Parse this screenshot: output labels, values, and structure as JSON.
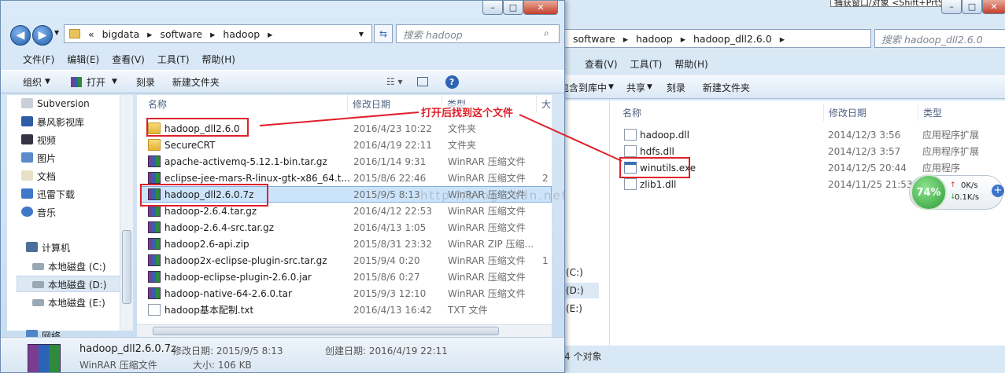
{
  "tooltip_text": "捕获窗口/对象 <Shift+PrtSc>",
  "left_window": {
    "address": [
      "«",
      "bigdata",
      "software",
      "hadoop"
    ],
    "search_placeholder": "搜索 hadoop",
    "menu": [
      "文件(F)",
      "编辑(E)",
      "查看(V)",
      "工具(T)",
      "帮助(H)"
    ],
    "toolbar": {
      "organize": "组织",
      "open": "打开",
      "burn": "刻录",
      "new_folder": "新建文件夹"
    },
    "nav": [
      "Subversion",
      "暴风影视库",
      "视频",
      "图片",
      "文档",
      "迅雷下载",
      "音乐",
      "计算机",
      "本地磁盘 (C:)",
      "本地磁盘 (D:)",
      "本地磁盘 (E:)",
      "网络"
    ],
    "columns": [
      "名称",
      "修改日期",
      "类型",
      "大"
    ],
    "files": [
      {
        "name": "hadoop_dll2.6.0",
        "date": "2016/4/23 10:22",
        "type": "文件夹",
        "size": "",
        "icon": "folder"
      },
      {
        "name": "SecureCRT",
        "date": "2016/4/19 22:11",
        "type": "文件夹",
        "size": "",
        "icon": "folder"
      },
      {
        "name": "apache-activemq-5.12.1-bin.tar.gz",
        "date": "2016/1/14 9:31",
        "type": "WinRAR 压缩文件",
        "size": "",
        "icon": "rar"
      },
      {
        "name": "eclipse-jee-mars-R-linux-gtk-x86_64.t...",
        "date": "2015/8/6 22:46",
        "type": "WinRAR 压缩文件",
        "size": "2",
        "icon": "rar"
      },
      {
        "name": "hadoop_dll2.6.0.7z",
        "date": "2015/9/5 8:13",
        "type": "WinRAR 压缩文件",
        "size": "",
        "icon": "rar"
      },
      {
        "name": "hadoop-2.6.4.tar.gz",
        "date": "2016/4/12 22:53",
        "type": "WinRAR 压缩文件",
        "size": "",
        "icon": "rar"
      },
      {
        "name": "hadoop-2.6.4-src.tar.gz",
        "date": "2016/4/13 1:05",
        "type": "WinRAR 压缩文件",
        "size": "",
        "icon": "rar"
      },
      {
        "name": "hadoop2.6-api.zip",
        "date": "2015/8/31 23:32",
        "type": "WinRAR ZIP 压缩...",
        "size": "",
        "icon": "rar"
      },
      {
        "name": "hadoop2x-eclipse-plugin-src.tar.gz",
        "date": "2015/9/4 0:20",
        "type": "WinRAR 压缩文件",
        "size": "1",
        "icon": "rar"
      },
      {
        "name": "hadoop-eclipse-plugin-2.6.0.jar",
        "date": "2015/8/6 0:27",
        "type": "WinRAR 压缩文件",
        "size": "",
        "icon": "rar"
      },
      {
        "name": "hadoop-native-64-2.6.0.tar",
        "date": "2015/9/3 12:10",
        "type": "WinRAR 压缩文件",
        "size": "",
        "icon": "rar"
      },
      {
        "name": "hadoop基本配制.txt",
        "date": "2016/4/13 16:42",
        "type": "TXT 文件",
        "size": "",
        "icon": "doc"
      }
    ],
    "annotation": "打开后找到这个文件",
    "watermark": "http://blog.csdn.net/",
    "details": {
      "filename": "hadoop_dll2.6.0.7z",
      "modified_label": "修改日期: 2015/9/5 8:13",
      "created_label": "创建日期: 2016/4/19 22:11",
      "type": "WinRAR 压缩文件",
      "size_label": "大小: 106 KB"
    }
  },
  "right_window": {
    "address": [
      "software",
      "hadoop",
      "hadoop_dll2.6.0"
    ],
    "search_placeholder": "搜索 hadoop_dll2.6.0",
    "menu": [
      "查看(V)",
      "工具(T)",
      "帮助(H)"
    ],
    "toolbar": {
      "include": "包含到库中",
      "share": "共享",
      "burn": "刻录",
      "new_folder": "新建文件夹"
    },
    "nav_partial": [
      "(C:)",
      "(D:)",
      "(E:)"
    ],
    "columns": [
      "名称",
      "修改日期",
      "类型"
    ],
    "files": [
      {
        "name": "hadoop.dll",
        "date": "2014/12/3 3:56",
        "type": "应用程序扩展",
        "icon": "doc"
      },
      {
        "name": "hdfs.dll",
        "date": "2014/12/3 3:57",
        "type": "应用程序扩展",
        "icon": "doc"
      },
      {
        "name": "winutils.exe",
        "date": "2014/12/5 20:44",
        "type": "应用程序",
        "icon": "exe"
      },
      {
        "name": "zlib1.dll",
        "date": "2014/11/25 21:53",
        "type": "应用程序扩展",
        "icon": "doc"
      }
    ],
    "status": "4 个对象",
    "net_widget": {
      "percent": "74%",
      "up": "0K/s",
      "down": "0.1K/s"
    }
  }
}
